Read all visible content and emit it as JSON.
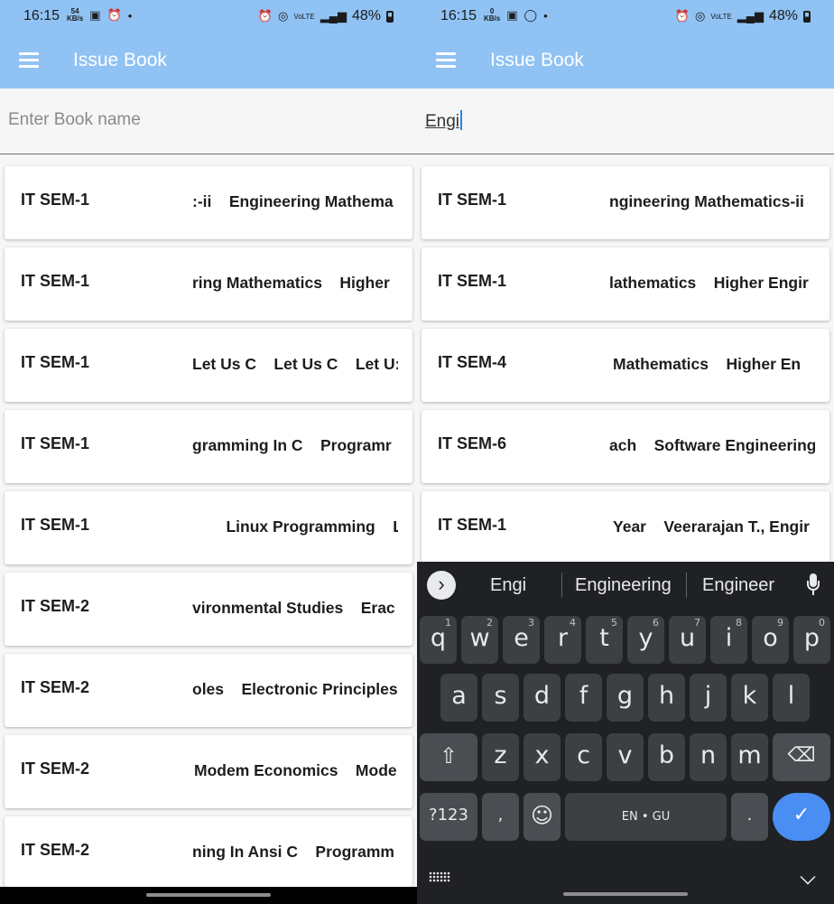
{
  "colors": {
    "app_bar": "#90c2f4",
    "keyboard_bg": "#202124",
    "key_bg": "#3c4043",
    "accent_enter": "#4a8ef3"
  },
  "left": {
    "status": {
      "time": "16:15",
      "net_speed_top": "54",
      "net_speed_bottom": "KB/s",
      "battery": "48%"
    },
    "appbar": {
      "title": "Issue Book"
    },
    "search": {
      "placeholder": "Enter Book name",
      "value": ""
    },
    "books": [
      {
        "sem": "IT SEM-1",
        "titles": ":-ii    Engineering Mathema"
      },
      {
        "sem": "IT SEM-1",
        "titles": "ring Mathematics    Higher"
      },
      {
        "sem": "IT SEM-1",
        "titles": "Let Us C    Let Us C    Let U:"
      },
      {
        "sem": "IT SEM-1",
        "titles": "gramming In C    Programr"
      },
      {
        "sem": "IT SEM-1",
        "titles": "    Linux Programming    Lir"
      },
      {
        "sem": "IT SEM-2",
        "titles": "vironmental Studies    Erac"
      },
      {
        "sem": "IT SEM-2",
        "titles": "oles    Electronic Principles"
      },
      {
        "sem": "IT SEM-2",
        "titles": "Modem Economics    Mode"
      },
      {
        "sem": "IT SEM-2",
        "titles": "ning In Ansi C    Programm"
      }
    ]
  },
  "right": {
    "status": {
      "time": "16:15",
      "net_speed_top": "0",
      "net_speed_bottom": "KB/s",
      "battery": "48%"
    },
    "appbar": {
      "title": "Issue Book"
    },
    "search": {
      "placeholder": "Enter Book name",
      "value": "Engi"
    },
    "books": [
      {
        "sem": "IT SEM-1",
        "titles": "ngineering Mathematics-ii"
      },
      {
        "sem": "IT SEM-1",
        "titles": "lathematics    Higher Engir"
      },
      {
        "sem": "IT SEM-4",
        "titles": "Mathematics    Higher En"
      },
      {
        "sem": "IT SEM-6",
        "titles": "ach    Software Engineering"
      },
      {
        "sem": "IT SEM-1",
        "titles": "Year    Veerarajan T., Engir"
      }
    ],
    "keyboard": {
      "suggestions": [
        "Engi",
        "Engineering",
        "Engineer"
      ],
      "row1": [
        "q",
        "w",
        "e",
        "r",
        "t",
        "y",
        "u",
        "i",
        "o",
        "p"
      ],
      "row1_hints": [
        "1",
        "2",
        "3",
        "4",
        "5",
        "6",
        "7",
        "8",
        "9",
        "0"
      ],
      "row2": [
        "a",
        "s",
        "d",
        "f",
        "g",
        "h",
        "j",
        "k",
        "l"
      ],
      "row3": [
        "z",
        "x",
        "c",
        "v",
        "b",
        "n",
        "m"
      ],
      "symbols_key": "?123",
      "comma_key": ",",
      "space_label": "EN • GU",
      "period_key": ".",
      "shift_glyph": "⇧",
      "backspace_glyph": "⌫",
      "emoji_glyph": "☺",
      "enter_glyph": "✓",
      "chevron_glyph": "›"
    }
  }
}
